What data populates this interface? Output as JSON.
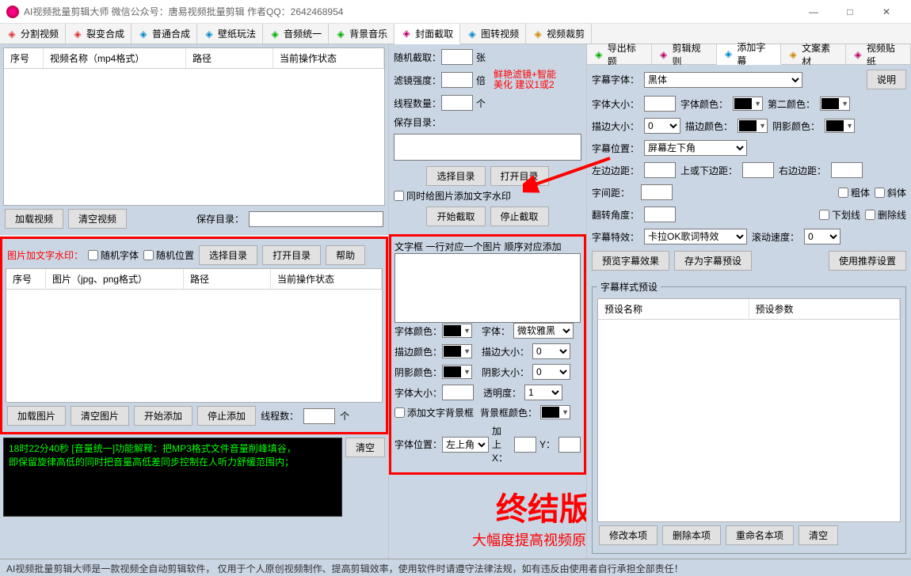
{
  "title": "AI视频批量剪辑大师    微信公众号：唐易视频批量剪辑    作者QQ：2642468954",
  "main_tabs": [
    "分割视频",
    "裂变合成",
    "普通合成",
    "壁纸玩法",
    "音频统一",
    "背景音乐",
    "封面截取",
    "图转视频",
    "视频裁剪"
  ],
  "main_tab_active": 6,
  "right_tabs": [
    "导出标题",
    "剪辑规则",
    "添加字幕",
    "文案素材",
    "视频贴纸"
  ],
  "right_tab_active": 2,
  "table1": {
    "cols": [
      "序号",
      "视频名称（mp4格式）",
      "路径",
      "当前操作状态"
    ]
  },
  "table2": {
    "cols": [
      "序号",
      "图片（jpg、png格式）",
      "路径",
      "当前操作状态"
    ]
  },
  "left": {
    "load_video": "加载视频",
    "clear_video": "清空视频",
    "save_dir_label": "保存目录：",
    "save_dir_value": "",
    "watermark_label": "图片加文字水印：",
    "random_font": "随机字体",
    "random_pos": "随机位置",
    "select_dir": "选择目录",
    "open_dir": "打开目录",
    "help": "帮助",
    "load_img": "加载图片",
    "clear_img": "清空图片",
    "start_add": "开始添加",
    "stop_add": "停止添加",
    "thread_count_label": "线程数：",
    "thread_count_value": "",
    "thread_unit": "个"
  },
  "mid": {
    "random_cap": "随机截取：",
    "random_cap_unit": "张",
    "filter_strength": "滤镜强度：",
    "filter_unit": "倍",
    "filter_note1": "鲜艳滤镜+智能",
    "filter_note2": "美化 建议1或2",
    "thread_qty": "线程数量：",
    "thread_unit": "个",
    "save_dir": "保存目录：",
    "select_dir": "选择目录",
    "open_dir": "打开目录",
    "add_watermark_check": "同时给图片添加文字水印",
    "start_cap": "开始截取",
    "stop_cap": "停止截取",
    "textbox_label": "文字框 一行对应一个图片 顺序对应添加",
    "font_color": "字体颜色：",
    "font_label": "字体：",
    "font_value": "微软雅黑",
    "stroke_color": "描边颜色：",
    "stroke_size": "描边大小：",
    "stroke_size_value": "0",
    "shadow_color": "阴影颜色：",
    "shadow_size": "阴影大小：",
    "shadow_size_value": "0",
    "font_size": "字体大小：",
    "opacity": "透明度：",
    "opacity_value": "1",
    "add_bg_box": "添加文字背景框",
    "bg_color": "背景框颜色：",
    "font_pos": "字体位置：",
    "font_pos_value": "左上角",
    "add_x": "加上X：",
    "add_y": "Y："
  },
  "right": {
    "explain_btn": "说明",
    "subtitle_font": "字幕字体：",
    "subtitle_font_value": "黑体",
    "font_size": "字体大小：",
    "font_color": "字体颜色：",
    "second_color": "第二颜色：",
    "stroke_size": "描边大小：",
    "stroke_size_value": "0",
    "stroke_color": "描边颜色：",
    "shadow_color": "阴影颜色：",
    "subtitle_pos": "字幕位置：",
    "subtitle_pos_value": "屏幕左下角",
    "left_margin": "左边边距：",
    "top_bottom_margin": "上或下边距：",
    "right_margin": "右边边距：",
    "letter_spacing": "字间距：",
    "bold": "粗体",
    "italic": "斜体",
    "rotate": "翻转角度：",
    "underline": "下划线",
    "strikethrough": "删除线",
    "effect": "字幕特效：",
    "effect_value": "卡拉OK歌词特效",
    "scroll_speed": "滚动速度：",
    "scroll_speed_value": "0",
    "preview": "预览字幕效果",
    "save_preset": "存为字幕预设",
    "use_recommend": "使用推荐设置",
    "preset_group": "字幕样式预设",
    "preset_cols": [
      "预设名称",
      "预设参数"
    ],
    "edit_item": "修改本项",
    "delete_item": "删除本项",
    "rename_item": "重命名本项",
    "clear": "清空"
  },
  "log": {
    "line1": "18时22分40秒 [音量统一]功能解释：把MP3格式文件音量削峰填谷，",
    "line2": "        即保留旋律高低的同时把音量高低差同步控制在人听力舒缓范围内；",
    "clear": "清空"
  },
  "promo": {
    "big": "终结版",
    "sub": "大幅度提高视频原创度"
  },
  "footer": "AI视频批量剪辑大师是一款视频全自动剪辑软件，  仅用于个人原创视频制作、提高剪辑效率，使用软件时请遵守法律法规，如有违反由使用者自行承担全部责任！"
}
